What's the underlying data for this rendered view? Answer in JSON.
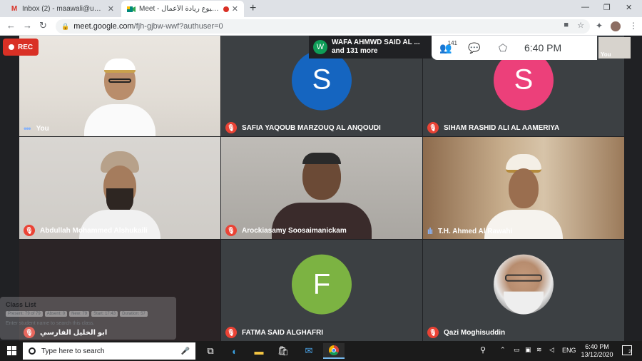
{
  "browser": {
    "tabs": [
      {
        "title": "Inbox (2) - maawali@unizwa.edu",
        "icon": "gmail-icon"
      },
      {
        "title": "Meet - ﺎﺗ أسبوع ريادة الأعمال",
        "icon": "meet-icon"
      }
    ],
    "new_tab": "+",
    "url_host": "meet.google.com",
    "url_path": "/fjh-gjbw-wwf?authuser=0"
  },
  "meet": {
    "rec_label": "REC",
    "notification": {
      "initial": "W",
      "line1": "WAFA AHMWD SAID AL ...",
      "line2": "and 131 more"
    },
    "participant_count": "141",
    "time": "6:40 PM",
    "self_thumb_label": "You",
    "tiles": [
      {
        "name": "You",
        "type": "video",
        "mic": "active"
      },
      {
        "name": "SAFIA YAQOUB MARZOUQ AL ANQOUDI",
        "type": "avatar",
        "initial": "S",
        "color": "#1565c0",
        "mic": "muted"
      },
      {
        "name": "SIHAM RASHID ALI AL AAMERIYA",
        "type": "avatar",
        "initial": "S",
        "color": "#ec407a",
        "mic": "muted"
      },
      {
        "name": "Abdullah Mohammed Alshukaili",
        "type": "video",
        "mic": "muted"
      },
      {
        "name": "Arockiasamy Soosaimanickam",
        "type": "video",
        "mic": "muted"
      },
      {
        "name": "T.H. Ahmed Al Rawahi",
        "type": "video",
        "mic": "active"
      },
      {
        "name": "ابو الخليل الفارسي",
        "type": "blank",
        "mic": "muted"
      },
      {
        "name": "FATMA SAID ALGHAFRI",
        "type": "avatar",
        "initial": "F",
        "color": "#7cb342",
        "mic": "muted"
      },
      {
        "name": "Qazi Moghisuddin",
        "type": "photo",
        "mic": "muted"
      }
    ],
    "class_list": {
      "title": "Class List",
      "chips": [
        "Present: 79 of 79",
        "Absent: 0",
        "New: 79",
        "Start: 17:43",
        "Duration: 57"
      ],
      "hint": "Enter student name to search this class."
    }
  },
  "taskbar": {
    "search_placeholder": "Type here to search",
    "language": "ENG",
    "clock_time": "6:40 PM",
    "clock_date": "13/12/2020",
    "notification_count": "2"
  }
}
